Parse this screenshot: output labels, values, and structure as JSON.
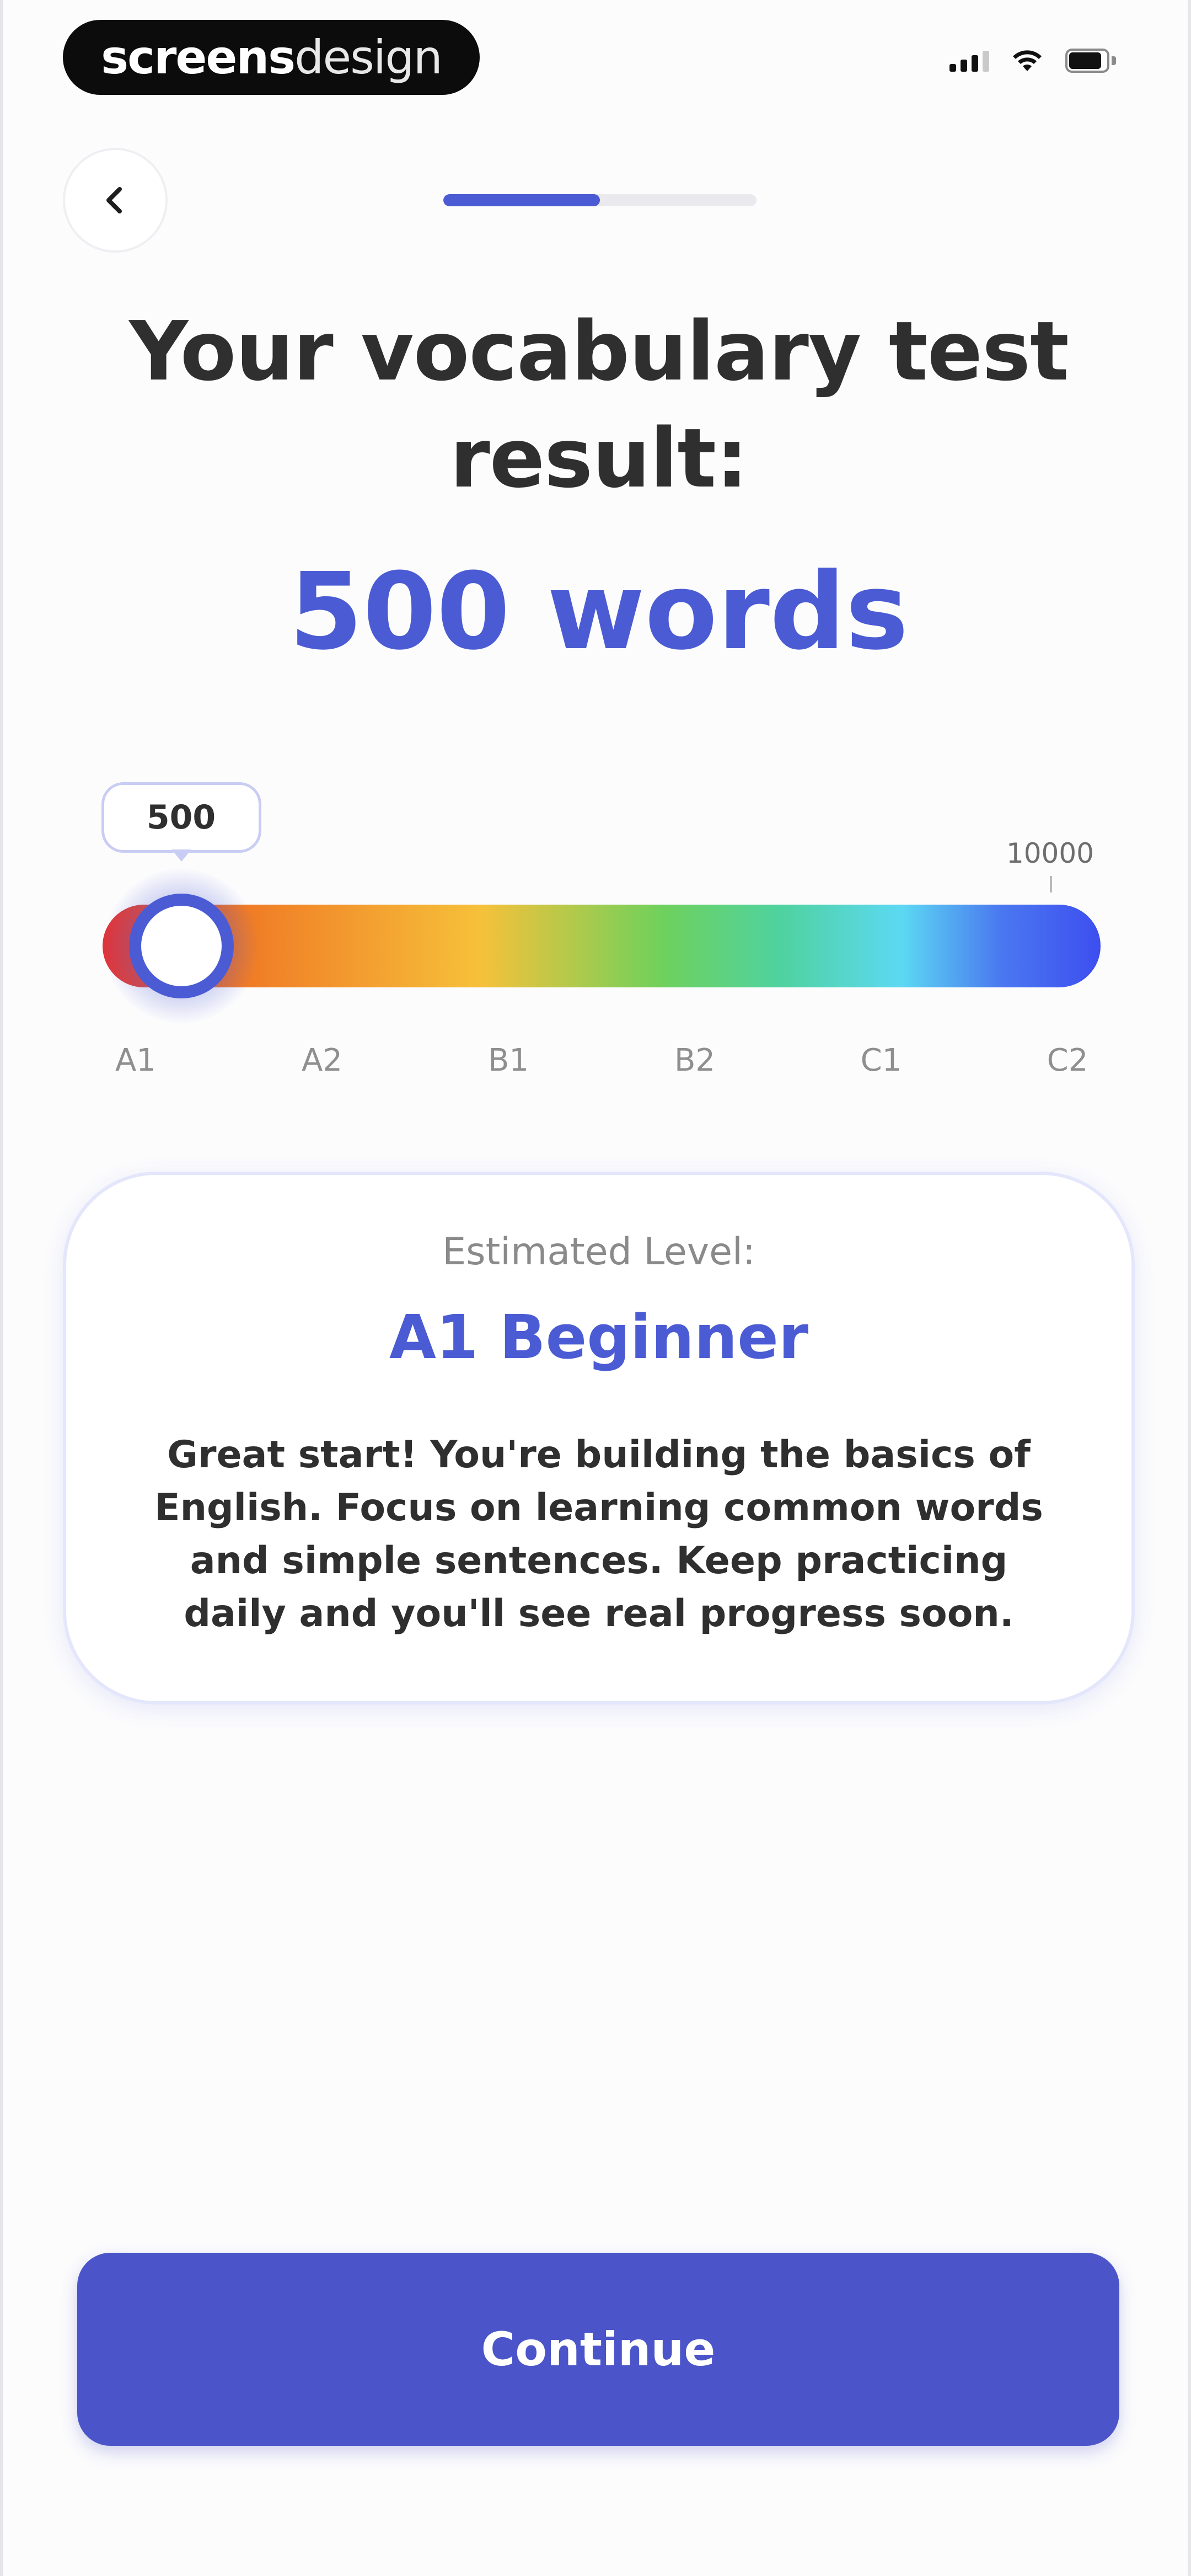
{
  "status_bar": {
    "brand_bold": "screens",
    "brand_light": "design"
  },
  "progress": {
    "fraction": 0.5
  },
  "title": "Your vocabulary test result:",
  "result": "500 words",
  "scale": {
    "current_value": "500",
    "max_value": "10000",
    "current_position": 0.05,
    "levels": [
      "A1",
      "A2",
      "B1",
      "B2",
      "C1",
      "C2"
    ]
  },
  "card": {
    "label": "Estimated Level:",
    "level": "A1 Beginner",
    "description": "Great start! You're building the basics of English. Focus on learning common words and simple sentences. Keep practicing daily and you'll see real progress soon."
  },
  "continue_button": {
    "label": "Continue"
  },
  "colors": {
    "accent": "#4b5bd4",
    "button": "#4b55c9"
  }
}
